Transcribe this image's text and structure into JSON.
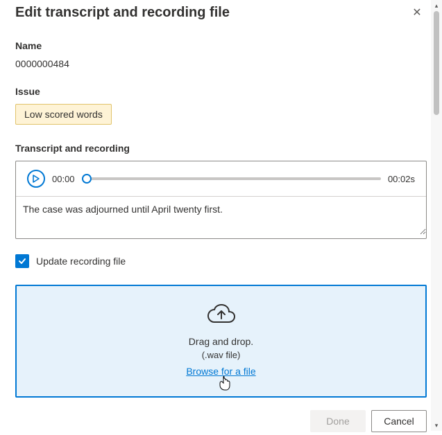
{
  "header": {
    "title": "Edit transcript and recording file",
    "close_glyph": "✕"
  },
  "name": {
    "label": "Name",
    "value": "0000000484"
  },
  "issue": {
    "label": "Issue",
    "tag": "Low scored words"
  },
  "transcript": {
    "label": "Transcript and recording",
    "current_time": "00:00",
    "duration": "00:02s",
    "text": "The case was adjourned until April twenty first."
  },
  "checkbox": {
    "label": "Update recording file",
    "checked": true
  },
  "dropzone": {
    "line1": "Drag and drop.",
    "line2": "(.wav file)",
    "browse": "Browse for a file"
  },
  "footer": {
    "done": "Done",
    "cancel": "Cancel"
  },
  "scrollbar": {
    "up": "▴",
    "down": "▾"
  }
}
